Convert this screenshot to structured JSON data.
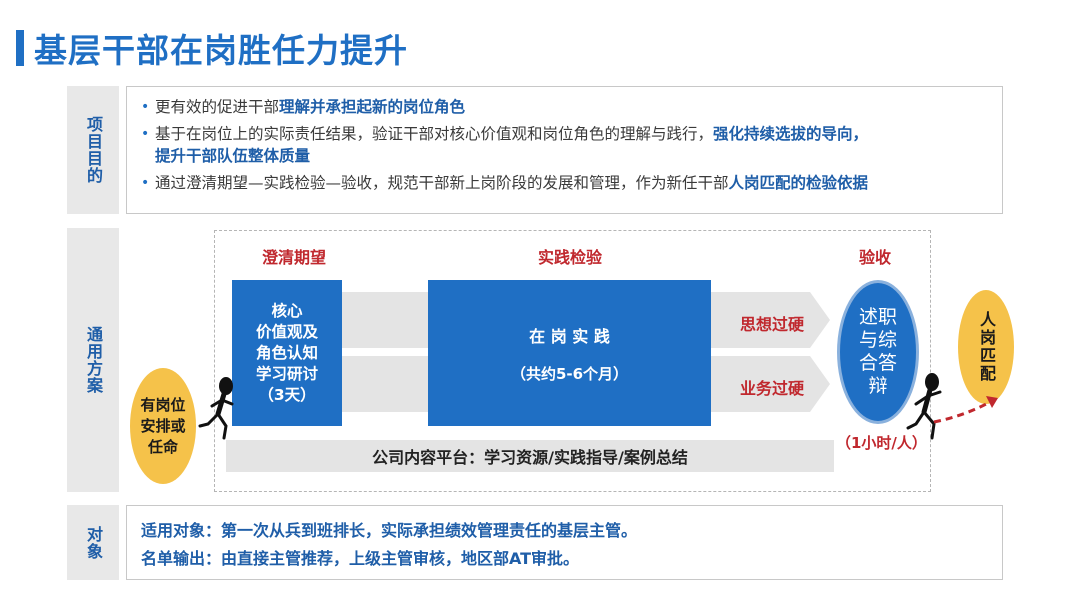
{
  "title": "基层干部在岗胜任力提升",
  "sections": {
    "purpose_label": "项目目的",
    "plan_label": "通用方案",
    "target_label": "对象"
  },
  "purpose": {
    "b1_pre": "更有效的促进干部",
    "b1_hl": "理解并承担起新的岗位角色",
    "b2_pre": "基于在岗位上的实际责任结果，验证干部对核心价值观和岗位角色的理解与践行，",
    "b2_hl": "强化持续选拔的导向，",
    "b2_line2": "提升干部队伍整体质量",
    "b3_pre": "通过澄清期望—实践检验—验收，规范干部新上岗阶段的发展和管理，作为新任干部",
    "b3_hl": "人岗匹配的检验依据"
  },
  "plan": {
    "phase1": "澄清期望",
    "phase2": "实践检验",
    "phase3": "验收",
    "block1": [
      "核心",
      "价值观及",
      "角色认知",
      "学习研讨",
      "（3天）"
    ],
    "block2_title": "在 岗 实 践",
    "block2_sub": "（共约5-6个月）",
    "exam1": "思想过硬",
    "exam2": "业务过硬",
    "platform": "公司内容平台：学习资源/实践指导/案例总结",
    "review": [
      "述职",
      "与综",
      "合答",
      "辩"
    ],
    "review_time": "（1小时/人）",
    "start": [
      "有岗位",
      "安排或",
      "任命"
    ],
    "end": "人岗匹配"
  },
  "target": {
    "line1": "适用对象：第一次从兵到班排长，实际承担绩效管理责任的基层主管。",
    "line2": "名单输出：由直接主管推荐，上级主管审核，地区部AT审批。"
  },
  "colors": {
    "blue": "#1f6fc4",
    "red": "#c0282e",
    "yellow": "#f5c24a",
    "gray": "#e4e4e4"
  }
}
